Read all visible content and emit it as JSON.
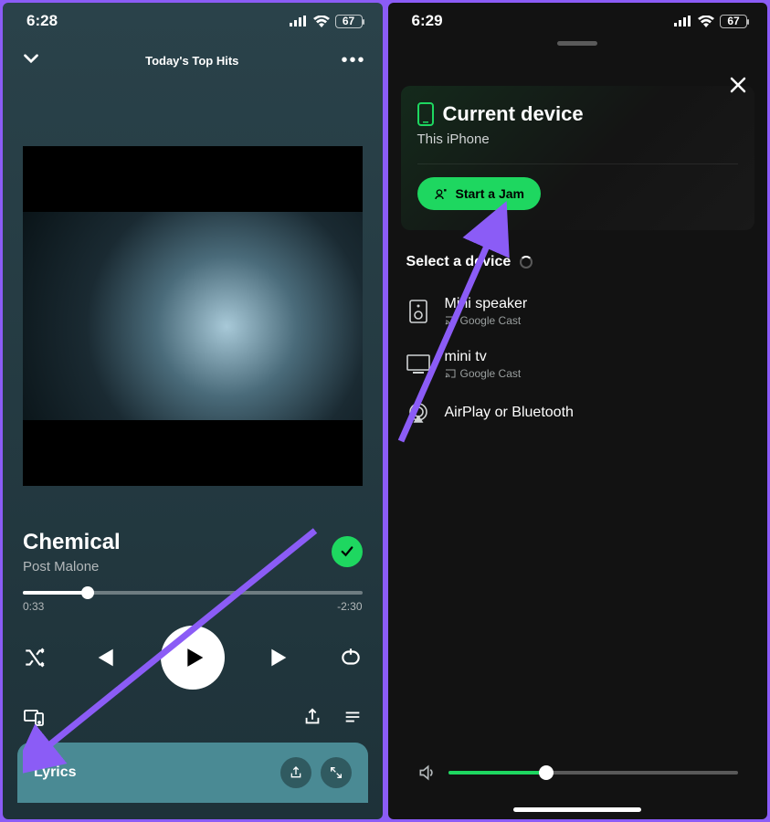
{
  "left": {
    "status": {
      "time": "6:28",
      "battery": "67"
    },
    "header": {
      "playlist": "Today's Top Hits"
    },
    "track": {
      "title": "Chemical",
      "artist": "Post Malone"
    },
    "progress": {
      "elapsed": "0:33",
      "remaining": "-2:30"
    },
    "lyrics": {
      "label": "Lyrics"
    }
  },
  "right": {
    "status": {
      "time": "6:29",
      "battery": "67"
    },
    "currentDevice": {
      "heading": "Current device",
      "name": "This iPhone",
      "jamLabel": "Start a Jam"
    },
    "selectLabel": "Select a device",
    "devices": [
      {
        "name": "Mini speaker",
        "meta": "Google Cast",
        "icon": "speaker"
      },
      {
        "name": "mini tv",
        "meta": "Google Cast",
        "icon": "tv"
      },
      {
        "name": "AirPlay or Bluetooth",
        "meta": "",
        "icon": "airplay"
      }
    ]
  }
}
